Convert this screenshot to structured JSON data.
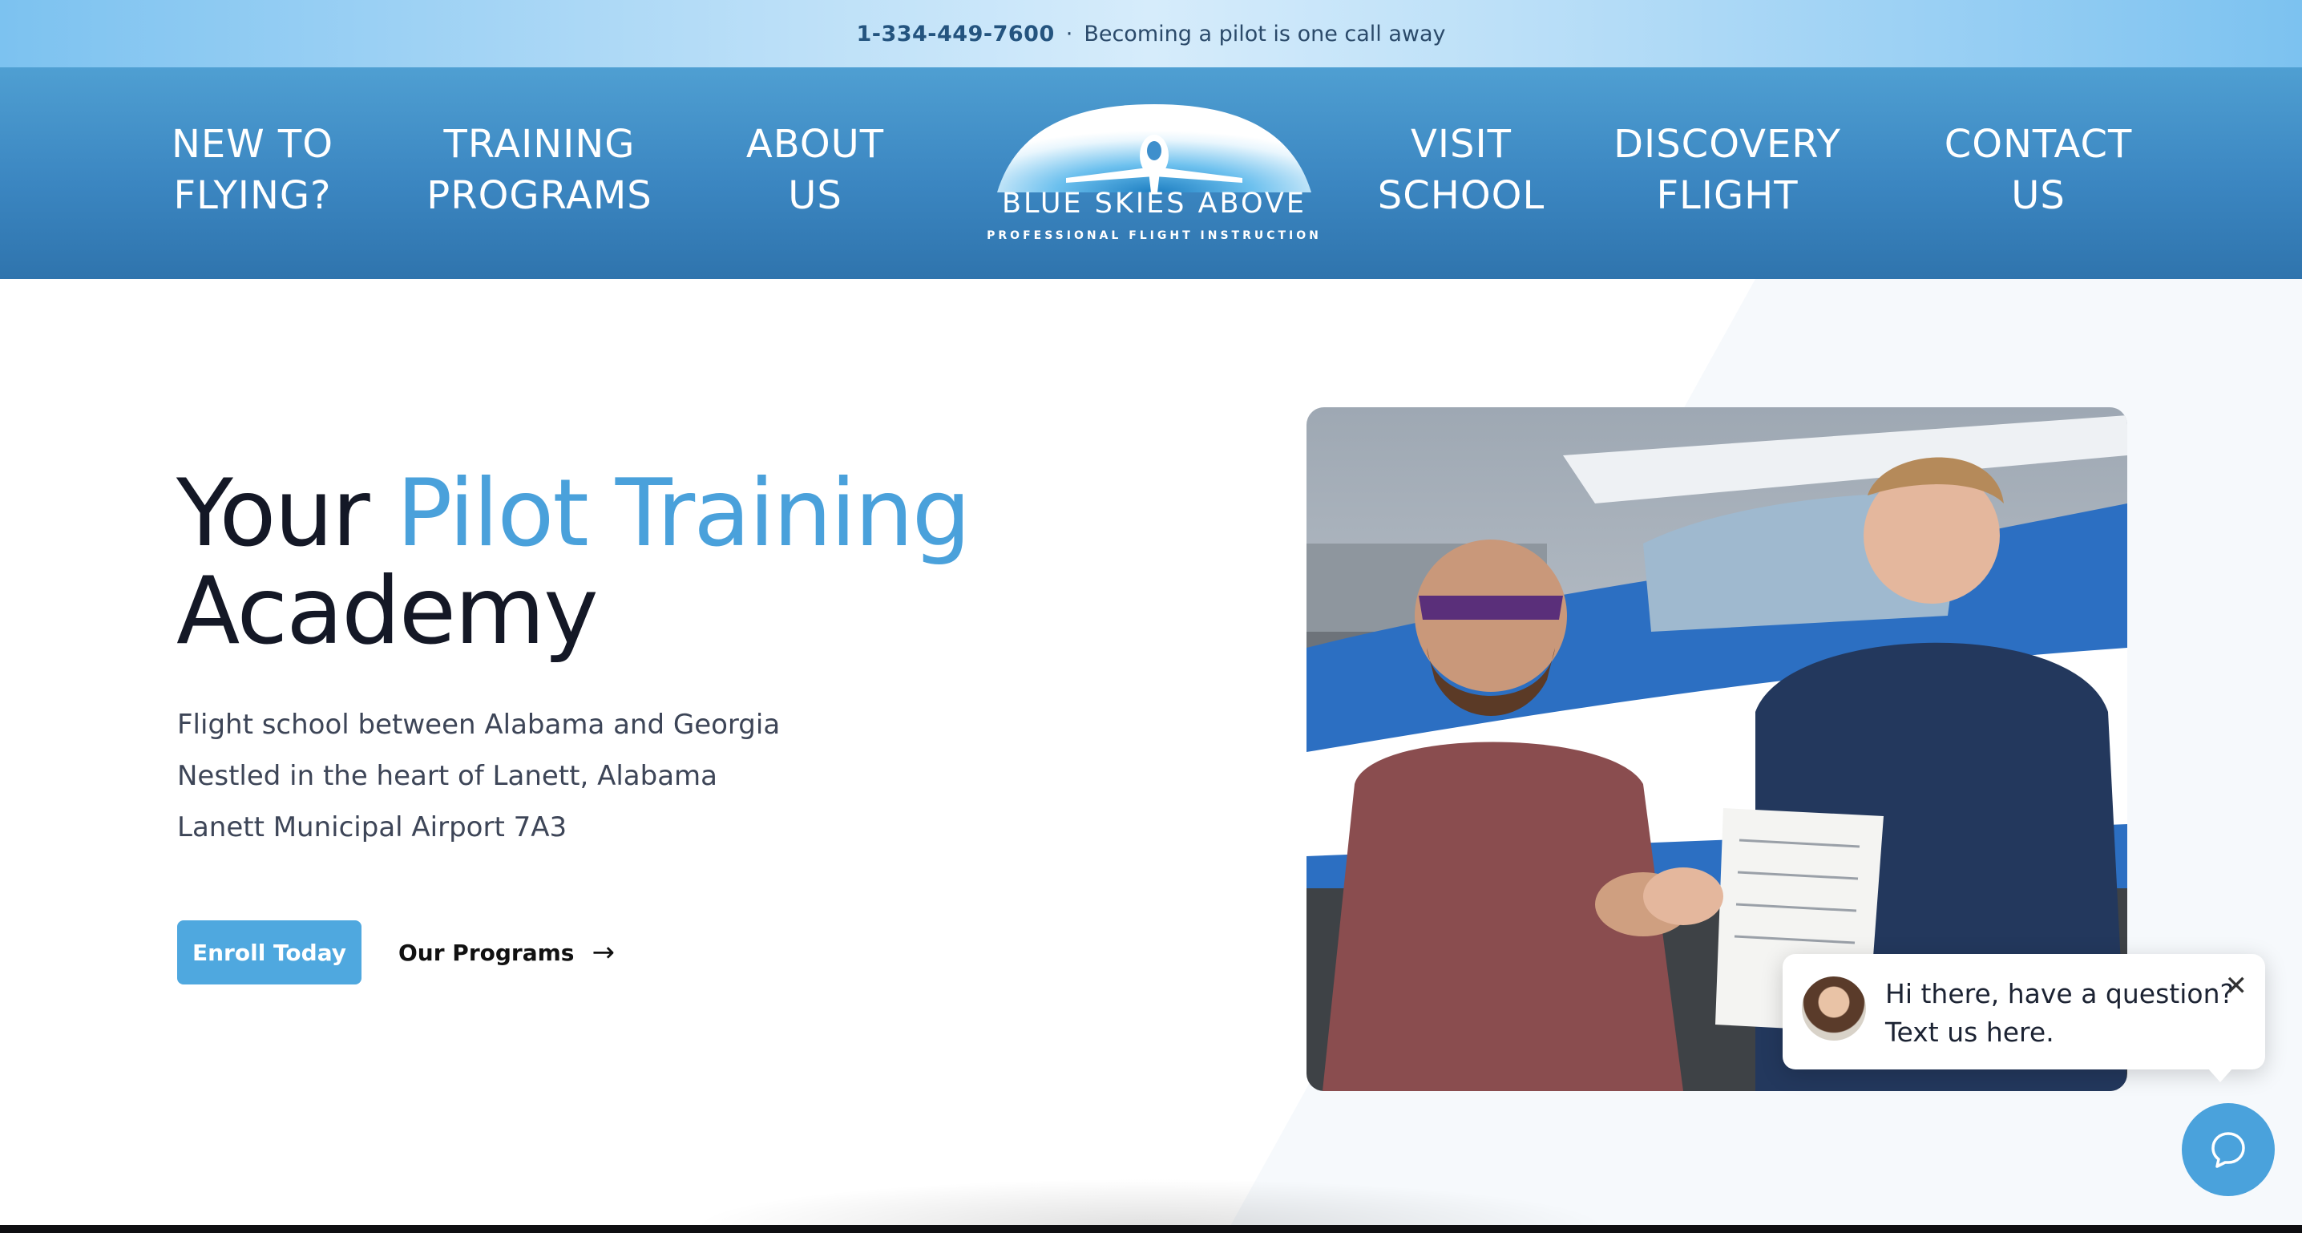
{
  "topbar": {
    "phone": "1-334-449-7600",
    "separator": "·",
    "tagline": "Becoming a pilot is one call away"
  },
  "nav": {
    "left": [
      {
        "line1": "NEW TO",
        "line2": "FLYING?"
      },
      {
        "line1": "TRAINING",
        "line2": "PROGRAMS"
      },
      {
        "line1": "ABOUT",
        "line2": "US"
      }
    ],
    "right": [
      {
        "line1": "VISIT",
        "line2": "SCHOOL"
      },
      {
        "line1": "DISCOVERY",
        "line2": "FLIGHT"
      },
      {
        "line1": "CONTACT",
        "line2": "US"
      }
    ],
    "logo_title": "BLUE SKIES ABOVE",
    "logo_subtitle": "PROFESSIONAL FLIGHT INSTRUCTION"
  },
  "hero": {
    "title_part1": "Your ",
    "title_accent": "Pilot Training",
    "title_part2": "Academy",
    "lines": [
      "Flight school between Alabama and Georgia",
      "Nestled in the heart of Lanett, Alabama",
      "Lanett Municipal Airport 7A3"
    ],
    "enroll_label": "Enroll Today",
    "programs_label": "Our Programs",
    "programs_arrow": "→"
  },
  "chat": {
    "line1": "Hi there, have a question?",
    "line2": "Text us here.",
    "close": "✕"
  },
  "colors": {
    "accent": "#4aa1db",
    "nav_bg": "#3b86c1",
    "topbar_bg": "#b4dcf7",
    "heading": "#141826"
  },
  "icons": {
    "logo": "airplane-dome-logo",
    "chat_fab": "chat-bubble-icon",
    "chat_close": "close-icon"
  }
}
